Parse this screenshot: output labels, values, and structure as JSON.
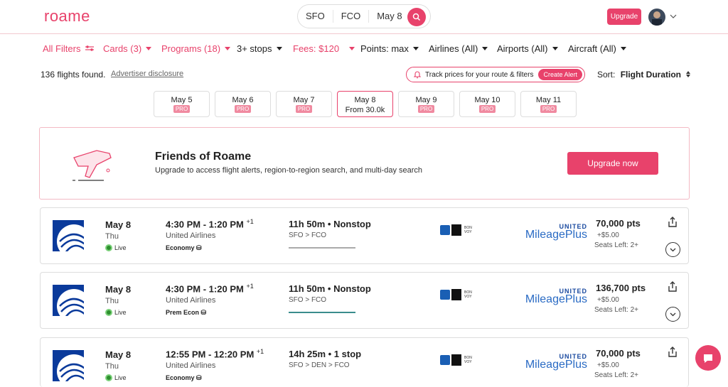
{
  "header": {
    "logo": "roame",
    "search": {
      "from": "SFO",
      "to": "FCO",
      "date": "May 8"
    },
    "upgrade_label": "Upgrade"
  },
  "filters": [
    {
      "label": "All Filters",
      "pink": true
    },
    {
      "label": "Cards (3)",
      "pink": true
    },
    {
      "label": "Programs (18)",
      "pink": true
    },
    {
      "label": "3+ stops",
      "pink": false
    },
    {
      "label": "Fees: $120",
      "pink": true
    },
    {
      "label": "Points: max",
      "pink": false
    },
    {
      "label": "Airlines (All)",
      "pink": false
    },
    {
      "label": "Airports (All)",
      "pink": false
    },
    {
      "label": "Aircraft (All)",
      "pink": false
    }
  ],
  "results": {
    "found": "136 flights found.",
    "advertiser": "Advertiser disclosure",
    "alert_text": "Track prices for your route & filters",
    "alert_button": "Create Alert",
    "sort_label": "Sort:",
    "sort_value": "Flight Duration"
  },
  "dates": [
    {
      "day": "May 5",
      "sub": "PRO"
    },
    {
      "day": "May 6",
      "sub": "PRO"
    },
    {
      "day": "May 7",
      "sub": "PRO"
    },
    {
      "day": "May 8",
      "sub": "From 30.0k"
    },
    {
      "day": "May 9",
      "sub": "PRO"
    },
    {
      "day": "May 10",
      "sub": "PRO"
    },
    {
      "day": "May 11",
      "sub": "PRO"
    }
  ],
  "banner": {
    "title": "Friends of Roame",
    "subtitle": "Upgrade to access flight alerts, region-to-region search, and multi-day search",
    "button": "Upgrade now"
  },
  "flights": [
    {
      "date": "May 8",
      "dow": "Thu",
      "live": "Live",
      "time": "4:30 PM - 1:20 PM",
      "plus": "+1",
      "airline": "United Airlines",
      "cabin": "Economy",
      "duration": "11h 50m • Nonstop",
      "route": "SFO > FCO",
      "bar_color": "#aaaaaa",
      "program_top": "UNITED",
      "program_bottom": "MileagePlus",
      "points": "70,000 pts",
      "fee": "+$5.00",
      "seats": "Seats Left: 2+"
    },
    {
      "date": "May 8",
      "dow": "Thu",
      "live": "Live",
      "time": "4:30 PM - 1:20 PM",
      "plus": "+1",
      "airline": "United Airlines",
      "cabin": "Prem Econ",
      "duration": "11h 50m • Nonstop",
      "route": "SFO > FCO",
      "bar_color": "#3a8c8c",
      "program_top": "UNITED",
      "program_bottom": "MileagePlus",
      "points": "136,700 pts",
      "fee": "+$5.00",
      "seats": "Seats Left: 2+"
    },
    {
      "date": "May 8",
      "dow": "Thu",
      "live": "Live",
      "time": "12:55 PM - 12:20 PM",
      "plus": "+1",
      "airline": "United Airlines",
      "cabin": "Economy",
      "duration": "14h 25m • 1 stop",
      "route": "SFO > DEN > FCO",
      "bar_color": "#aaaaaa",
      "program_top": "UNITED",
      "program_bottom": "MileagePlus",
      "points": "70,000 pts",
      "fee": "+$5.00",
      "seats": "Seats Left: 2+"
    }
  ],
  "colors": {
    "accent": "#e8426b",
    "united_blue": "#0a3a9b"
  }
}
